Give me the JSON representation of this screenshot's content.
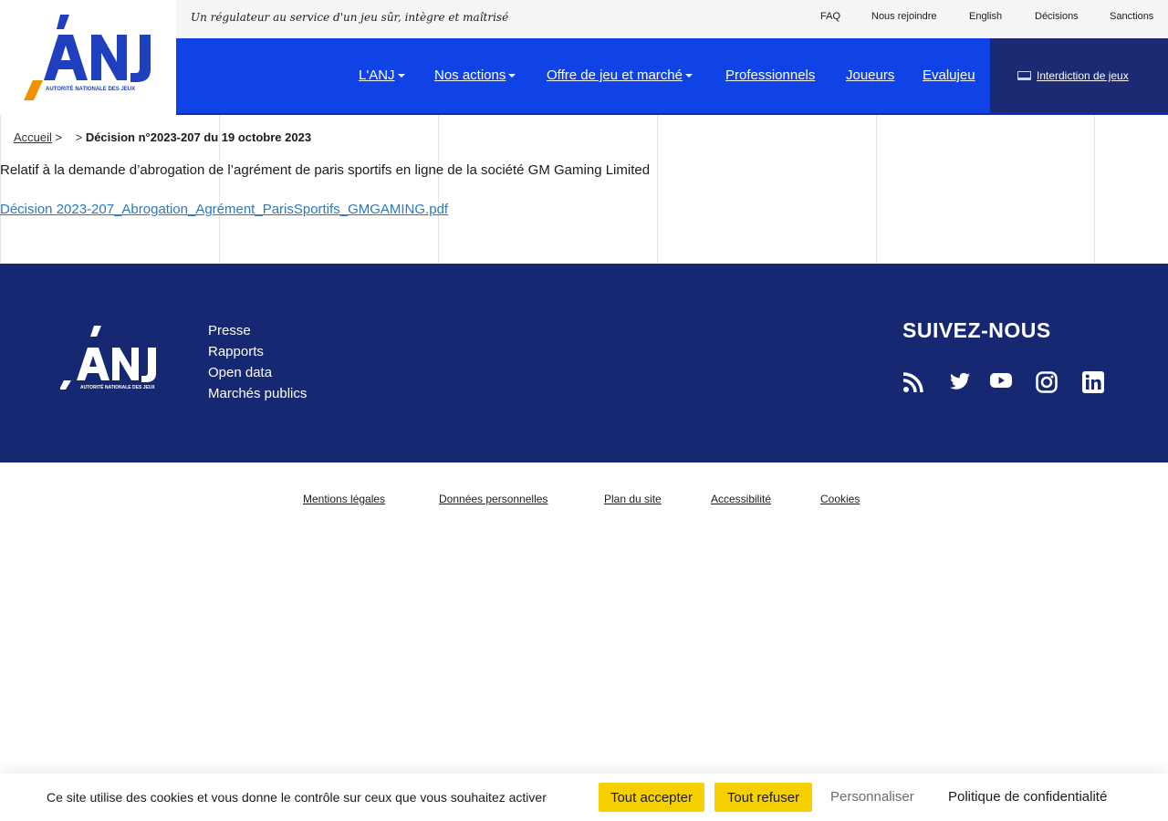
{
  "header": {
    "logo_text": "ANJ",
    "logo_subtitle": "AUTORITÉ NATIONALE DES JEUX",
    "tagline": "Un régulateur au service d'un jeu sûr, intègre et maîtrisé",
    "top_links": [
      "FAQ",
      "Nous rejoindre",
      "English",
      "Décisions",
      "Sanctions"
    ],
    "nav": [
      "L'ANJ",
      "Nos actions",
      "Offre de jeu et marché",
      "Professionnels",
      "Joueurs",
      "Evalujeu"
    ],
    "interdiction_label": "Interdiction de jeux"
  },
  "breadcrumb": {
    "home": "Accueil",
    "sep1": ">",
    "sep2": ">",
    "current": "Décision n°2023-207 du 19 octobre 2023"
  },
  "content": {
    "intro": "Relatif à la demande d’abrogation de l’agrément de paris sportifs en ligne de la société GM Gaming Limited",
    "pdf_link": "Décision 2023-207_Abrogation_Agrément_ParisSportifs_GMGAMING.pdf"
  },
  "footer": {
    "logo_text": "ANJ",
    "logo_subtitle": "AUTORITÉ NATIONALE DES JEUX",
    "links": [
      "Presse",
      "Rapports",
      "Open data",
      "Marchés publics"
    ],
    "follow_title": "SUIVEZ-NOUS",
    "social_icons": [
      "rss-icon",
      "twitter-icon",
      "youtube-icon",
      "instagram-icon",
      "linkedin-icon"
    ]
  },
  "bottom_links": [
    "Mentions légales",
    "Données personnelles",
    "Plan du site",
    "Accessibilité",
    "Cookies"
  ],
  "cookie_bar": {
    "message": "Ce site utilise des cookies et vous donne le contrôle sur ceux que vous souhaitez activer",
    "accept": "Tout accepter",
    "refuse": "Tout refuser",
    "customize": "Personnaliser",
    "privacy": "Politique de confidentialité"
  },
  "colors": {
    "nav_blue": "#0f43e6",
    "footer_navy": "#172873",
    "interdiction_bg": "#1b2a73",
    "logo_orange": "#f29100",
    "link_blue": "#2a79c1",
    "cookie_yellow": "#f5d000"
  }
}
